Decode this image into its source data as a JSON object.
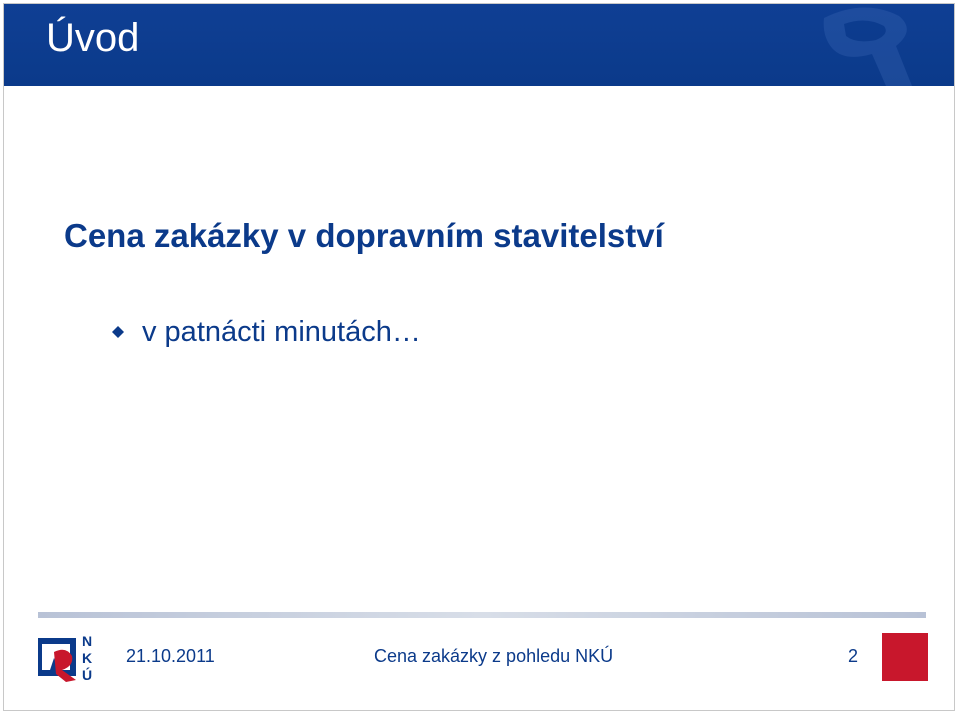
{
  "header": {
    "title": "Úvod"
  },
  "content": {
    "main_title": "Cena zakázky v dopravním stavitelství",
    "bullets": [
      {
        "text": "v patnácti minutách…",
        "icon": "diamond-bullet-icon"
      }
    ]
  },
  "footer": {
    "date": "21.10.2011",
    "center_text": "Cena zakázky z pohledu NKÚ",
    "page_number": "2",
    "logo_letters": [
      "N",
      "K",
      "Ú"
    ]
  },
  "colors": {
    "header_bg": "#0b3a8a",
    "text_blue": "#0b3a8a",
    "accent_red": "#c8172c",
    "footer_line": "#c4ccdc"
  }
}
